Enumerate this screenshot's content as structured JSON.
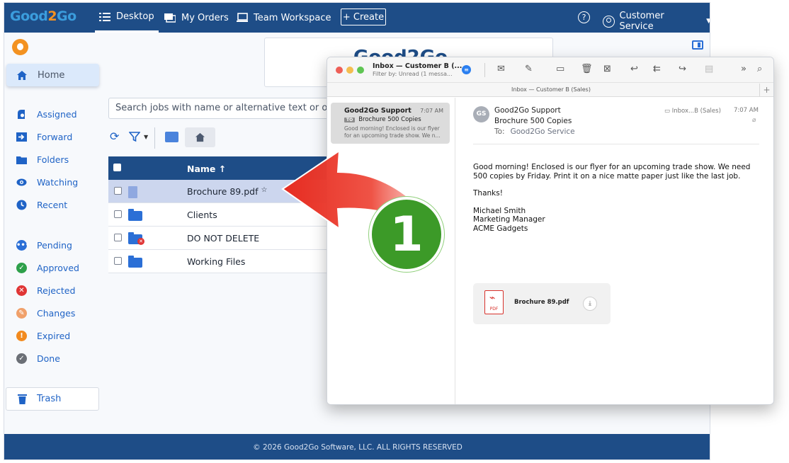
{
  "app": {
    "logo": {
      "part1": "Good",
      "part2": "2",
      "part3": "Go"
    },
    "nav": [
      {
        "label": "Desktop",
        "icon": "list-icon",
        "active": true
      },
      {
        "label": "My Orders",
        "icon": "orders-icon"
      },
      {
        "label": "Team Workspace",
        "icon": "workspace-icon"
      }
    ],
    "create_label": "+ Create",
    "help_label": "?",
    "user_label": "Customer Service",
    "banner_logo": "Good2Go",
    "sidebar": {
      "home": "Home",
      "items": [
        {
          "label": "Assigned",
          "icon": "assigned-icon"
        },
        {
          "label": "Forward",
          "icon": "forward-icon"
        },
        {
          "label": "Folders",
          "icon": "folder-icon"
        },
        {
          "label": "Watching",
          "icon": "eye-icon"
        },
        {
          "label": "Recent",
          "icon": "recent-icon"
        }
      ],
      "statuses": [
        {
          "label": "Pending",
          "icon": "pending-icon",
          "color": "#2b6fd6",
          "glyph": "•••"
        },
        {
          "label": "Approved",
          "icon": "check-icon",
          "color": "#2ea04a",
          "glyph": "✓"
        },
        {
          "label": "Rejected",
          "icon": "x-icon",
          "color": "#e03535",
          "glyph": "✕"
        },
        {
          "label": "Changes",
          "icon": "pencil-icon",
          "color": "#f0a06a",
          "glyph": "✎"
        },
        {
          "label": "Expired",
          "icon": "alert-icon",
          "color": "#f28a1e",
          "glyph": "!"
        },
        {
          "label": "Done",
          "icon": "done-icon",
          "color": "#6b6f76",
          "glyph": "✓"
        }
      ],
      "trash": "Trash"
    },
    "search_placeholder": "Search jobs with name or alternative text or orde",
    "table": {
      "header": "Name ↑",
      "rows": [
        {
          "name": "Brochure 89.pdf",
          "type": "file",
          "selected": true,
          "star": "☆"
        },
        {
          "name": "Clients",
          "type": "folder"
        },
        {
          "name": "DO NOT DELETE",
          "type": "folder-error"
        },
        {
          "name": "Working Files",
          "type": "folder"
        }
      ]
    },
    "footer": "© 2026 Good2Go Software, LLC. ALL RIGHTS RESERVED"
  },
  "step_number": "1",
  "mail": {
    "title": "Inbox — Customer B (...",
    "subtitle": "Filter by: Unread (1 messa...",
    "pane_title": "Inbox — Customer B (Sales)",
    "list_item": {
      "from": "Good2Go Support",
      "time": "7:07 AM",
      "to_badge": "TO",
      "subject": "Brochure 500 Copies",
      "preview": "Good morning! Enclosed is our flyer for an upcoming trade show. We n..."
    },
    "message": {
      "avatar": "GS",
      "from": "Good2Go Support",
      "subject": "Brochure 500 Copies",
      "to_label": "To:",
      "to_value": "Good2Go Service",
      "mailbox": "Inbox...B (Sales)",
      "time": "7:07 AM",
      "body1": "Good morning! Enclosed is our flyer for an upcoming trade show. We need 500 copies by Friday. Print it on a nice matte paper just like the last job.",
      "body2": "Thanks!",
      "sig1": "Michael Smith",
      "sig2": "Marketing Manager",
      "sig3": "ACME Gadgets",
      "attachment": "Brochure 89.pdf",
      "attachment_type": "PDF"
    }
  }
}
